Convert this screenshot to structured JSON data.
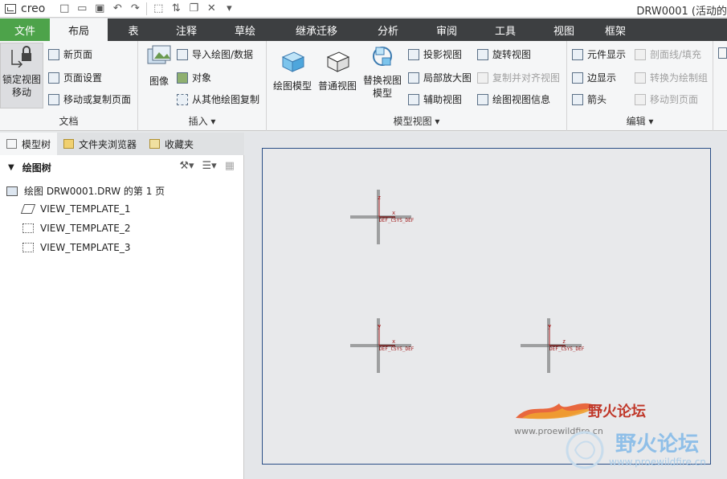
{
  "app": {
    "brand": "creo",
    "window_title": "DRW0001 (活动的"
  },
  "tabs": [
    "文件",
    "布局",
    "表",
    "注释",
    "草绘",
    "继承迁移",
    "分析",
    "审阅",
    "工具",
    "视图",
    "框架"
  ],
  "ribbon": {
    "doc_group": {
      "label": "文档",
      "lock_view": "锁定视图移动",
      "new_page": "新页面",
      "page_setup": "页面设置",
      "move_copy_page": "移动或复制页面"
    },
    "insert_group": {
      "label": "插入",
      "image": "图像",
      "import_drawing": "导入绘图/数据",
      "object": "对象",
      "copy_from_other": "从其他绘图复制"
    },
    "model_view_group": {
      "label": "模型视图",
      "drawing_model": "绘图模型",
      "general_view": "普通视图",
      "replace_view_model": "替换视图模型",
      "projection_view": "投影视图",
      "detailed_view": "局部放大图",
      "auxiliary_view": "辅助视图",
      "rotate_view": "旋转视图",
      "copy_align_view": "复制并对齐视图",
      "drawing_view_info": "绘图视图信息"
    },
    "edit_group": {
      "label": "编辑",
      "component_display": "元件显示",
      "edge_display": "边显示",
      "arrow": "箭头",
      "section_fill": "剖面线/填充",
      "convert_to_drawing": "转换为绘制组",
      "move_to_page": "移动到页面"
    }
  },
  "left_panel": {
    "tabs": [
      "模型树",
      "文件夹浏览器",
      "收藏夹"
    ],
    "tree_title": "绘图树",
    "tree_root": "绘图 DRW0001.DRW 的第 1 页",
    "items": [
      "VIEW_TEMPLATE_1",
      "VIEW_TEMPLATE_2",
      "VIEW_TEMPLATE_3"
    ]
  },
  "views": [
    {
      "axis_label": "z",
      "x_label": "x",
      "csys_label": "DEF_CSYS_DEF"
    },
    {
      "axis_label": "y",
      "x_label": "x",
      "csys_label": "DEF_CSYS_DEF"
    },
    {
      "axis_label": "y",
      "x_label": "z",
      "csys_label": "DEF_CSYS_DEF"
    }
  ],
  "watermark": {
    "name": "野火论坛",
    "url": "www.proewildfire.cn",
    "url2": "www.proewildfire.cn"
  },
  "colors": {
    "file_tab": "#4da34a",
    "tabbar": "#3d3f41",
    "sheet_border": "#2a4e86",
    "axis_red": "#a01818"
  }
}
